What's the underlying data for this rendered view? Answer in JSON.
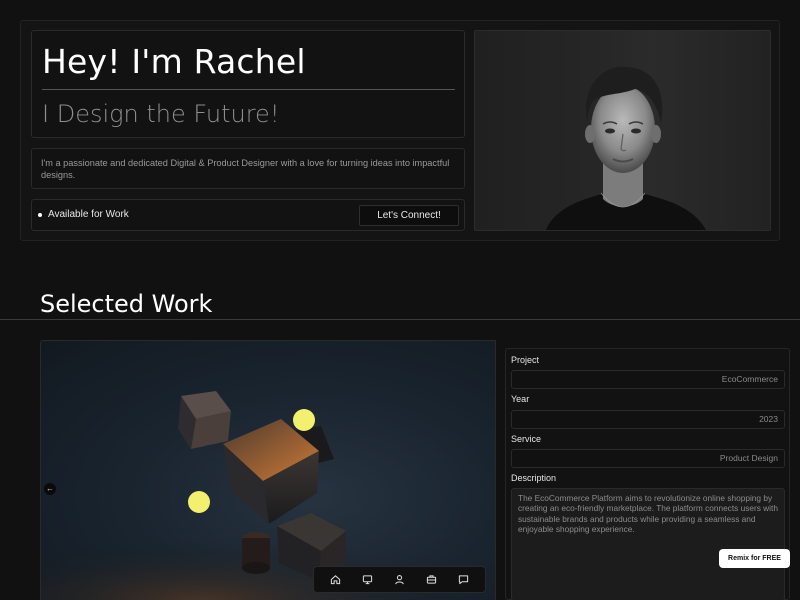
{
  "hero": {
    "name": "Hey! I'm Rachel",
    "tagline": "I Design the Future!",
    "bio": "I'm a passionate and dedicated Digital & Product Designer with a love for turning ideas into impactful designs.",
    "status": "Available for Work",
    "connect_label": "Let's Connect!"
  },
  "work": {
    "section_title": "Selected Work",
    "project_label": "Project",
    "project_value": "EcoCommerce",
    "year_label": "Year",
    "year_value": "2023",
    "service_label": "Service",
    "service_value": "Product Design",
    "description_label": "Description",
    "description_value": "The EcoCommerce Platform aims to revolutionize online shopping by creating an eco-friendly marketplace. The platform connects users with sustainable brands and products while providing a seamless and enjoyable shopping experience."
  },
  "dock": {
    "items": [
      "home-icon",
      "desktop-icon",
      "user-icon",
      "briefcase-icon",
      "chat-icon"
    ]
  },
  "remix_label": "Remix for FREE",
  "colors": {
    "background": "#111111",
    "panel": "#141414",
    "border": "#2a2a2a",
    "muted_text": "#8f8f8f",
    "accent_sphere": "#f3ef6f",
    "cube_glow": "#c7692b"
  }
}
